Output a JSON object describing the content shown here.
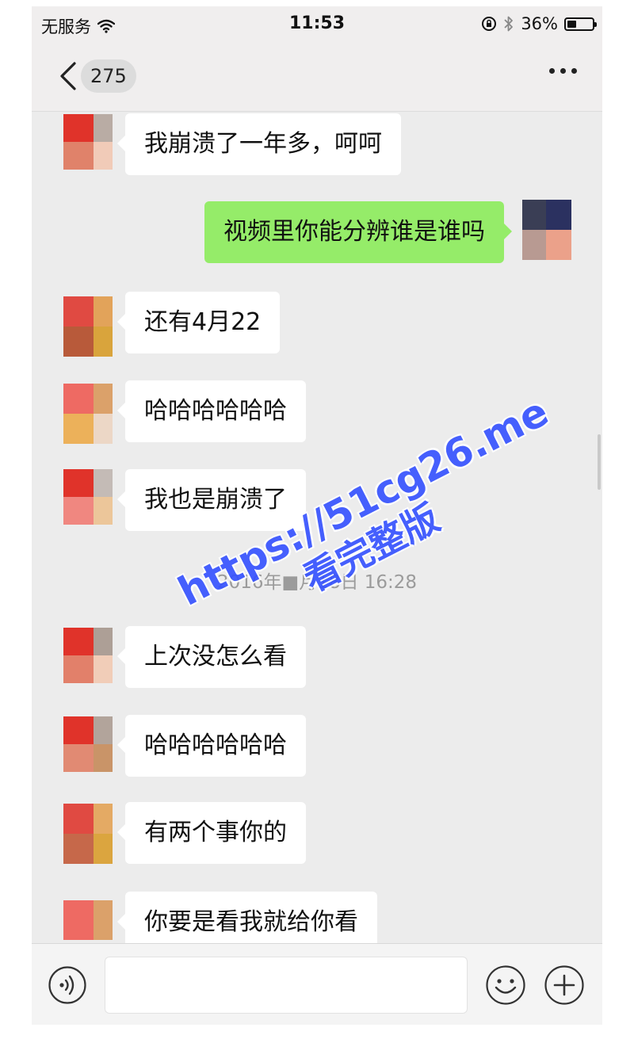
{
  "status_bar": {
    "carrier": "无服务",
    "time": "11:53",
    "battery": "36%"
  },
  "nav": {
    "unread_count": "275"
  },
  "messages": [
    {
      "side": "left",
      "text": "我崩溃了一年多，呵呵"
    },
    {
      "side": "right",
      "text": "视频里你能分辨谁是谁吗"
    },
    {
      "side": "left",
      "text": "还有4月22"
    },
    {
      "side": "left",
      "text": "哈哈哈哈哈哈"
    },
    {
      "side": "left",
      "text": "我也是崩溃了"
    },
    {
      "side": "left",
      "text": "上次没怎么看"
    },
    {
      "side": "left",
      "text": "哈哈哈哈哈哈"
    },
    {
      "side": "left",
      "text": "有两个事你的"
    },
    {
      "side": "left",
      "text": "你要是看我就给你看"
    }
  ],
  "timestamp": "2016年■月18日 16:28",
  "input": {
    "value": ""
  },
  "watermark": {
    "url": "https://51cg26.me",
    "subtitle": "看完整版"
  },
  "colors": {
    "sent_bubble": "#95ec69",
    "received_bubble": "#ffffff",
    "background": "#ececec",
    "watermark": "#3450ff"
  }
}
